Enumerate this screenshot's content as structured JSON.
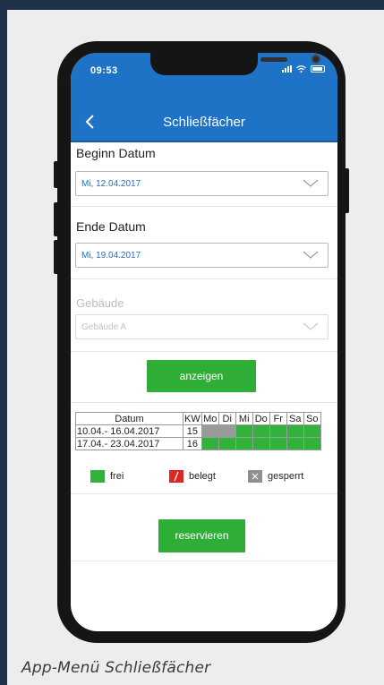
{
  "status_bar": {
    "time": "09:53"
  },
  "header": {
    "title": "Schließfächer"
  },
  "form": {
    "begin_label": "Beginn Datum",
    "begin_value": "Mi, 12.04.2017",
    "end_label": "Ende Datum",
    "end_value": "Mi, 19.04.2017",
    "building_label": "Gebäude",
    "building_value": "Gebäude A"
  },
  "buttons": {
    "show": "anzeigen",
    "reserve": "reservieren"
  },
  "calendar": {
    "headers": [
      "Datum",
      "KW",
      "Mo",
      "Di",
      "Mi",
      "Do",
      "Fr",
      "Sa",
      "So"
    ],
    "rows": [
      {
        "date": "10.04.- 16.04.2017",
        "kw": "15",
        "days": [
          "gesperrt",
          "gesperrt",
          "frei",
          "frei",
          "frei",
          "frei",
          "frei"
        ]
      },
      {
        "date": "17.04.- 23.04.2017",
        "kw": "16",
        "days": [
          "frei",
          "frei",
          "frei",
          "frei",
          "frei",
          "frei",
          "frei"
        ]
      }
    ]
  },
  "legend": {
    "free": "frei",
    "occupied": "belegt",
    "blocked": "gesperrt"
  },
  "colors": {
    "primary": "#1f73c7",
    "free": "#31b33b",
    "occupied": "#e02424",
    "blocked": "#9a9a9a",
    "button": "#2fae37"
  },
  "caption": "App-Menü Schließfächer"
}
